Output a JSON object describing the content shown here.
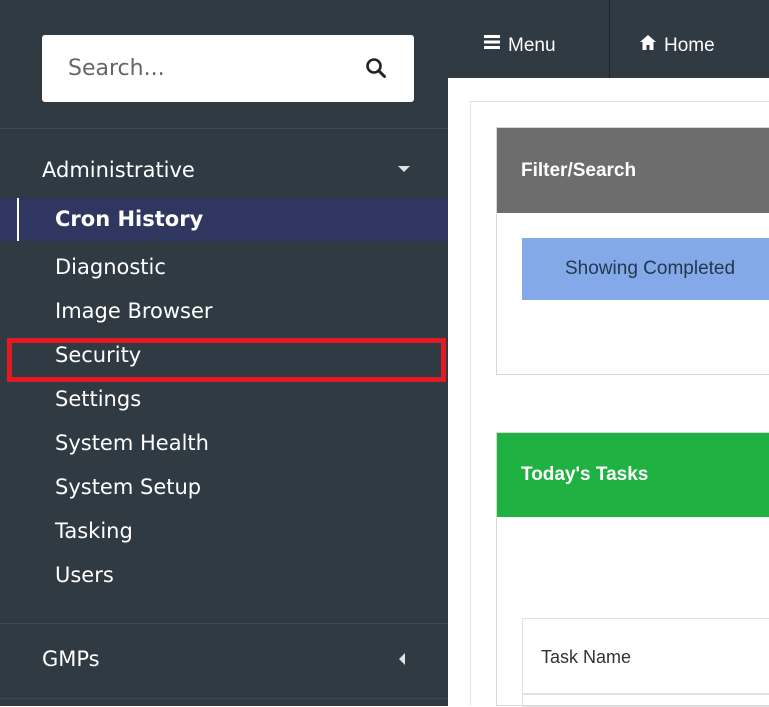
{
  "search": {
    "placeholder": "Search..."
  },
  "sidebar": {
    "sections": [
      {
        "label": "Administrative",
        "expanded": true,
        "items": [
          {
            "label": "Cron History",
            "active": true
          },
          {
            "label": "Diagnostic"
          },
          {
            "label": "Image Browser"
          },
          {
            "label": "Security",
            "highlighted": true
          },
          {
            "label": "Settings"
          },
          {
            "label": "System Health"
          },
          {
            "label": "System Setup"
          },
          {
            "label": "Tasking"
          },
          {
            "label": "Users"
          }
        ]
      },
      {
        "label": "GMPs",
        "expanded": false
      }
    ]
  },
  "topbar": {
    "menu_label": "Menu",
    "home_label": "Home"
  },
  "main": {
    "filter_panel": {
      "title": "Filter/Search",
      "alert_text": "Showing Completed"
    },
    "tasks_panel": {
      "title": "Today's Tasks",
      "columns": [
        "Task Name"
      ]
    }
  },
  "colors": {
    "sidebar_bg": "#2f3a42",
    "active_item_bg": "#2f3760",
    "highlight_border": "#e21b22",
    "filter_heading": "#6d6d6d",
    "tasks_heading": "#1fb141",
    "info_alert": "#84a9e8"
  },
  "icons": {
    "search": "search-icon",
    "menu": "menu-icon",
    "home": "home-icon",
    "administrative_caret": "caret-down-icon",
    "gmps_caret": "caret-left-icon"
  }
}
